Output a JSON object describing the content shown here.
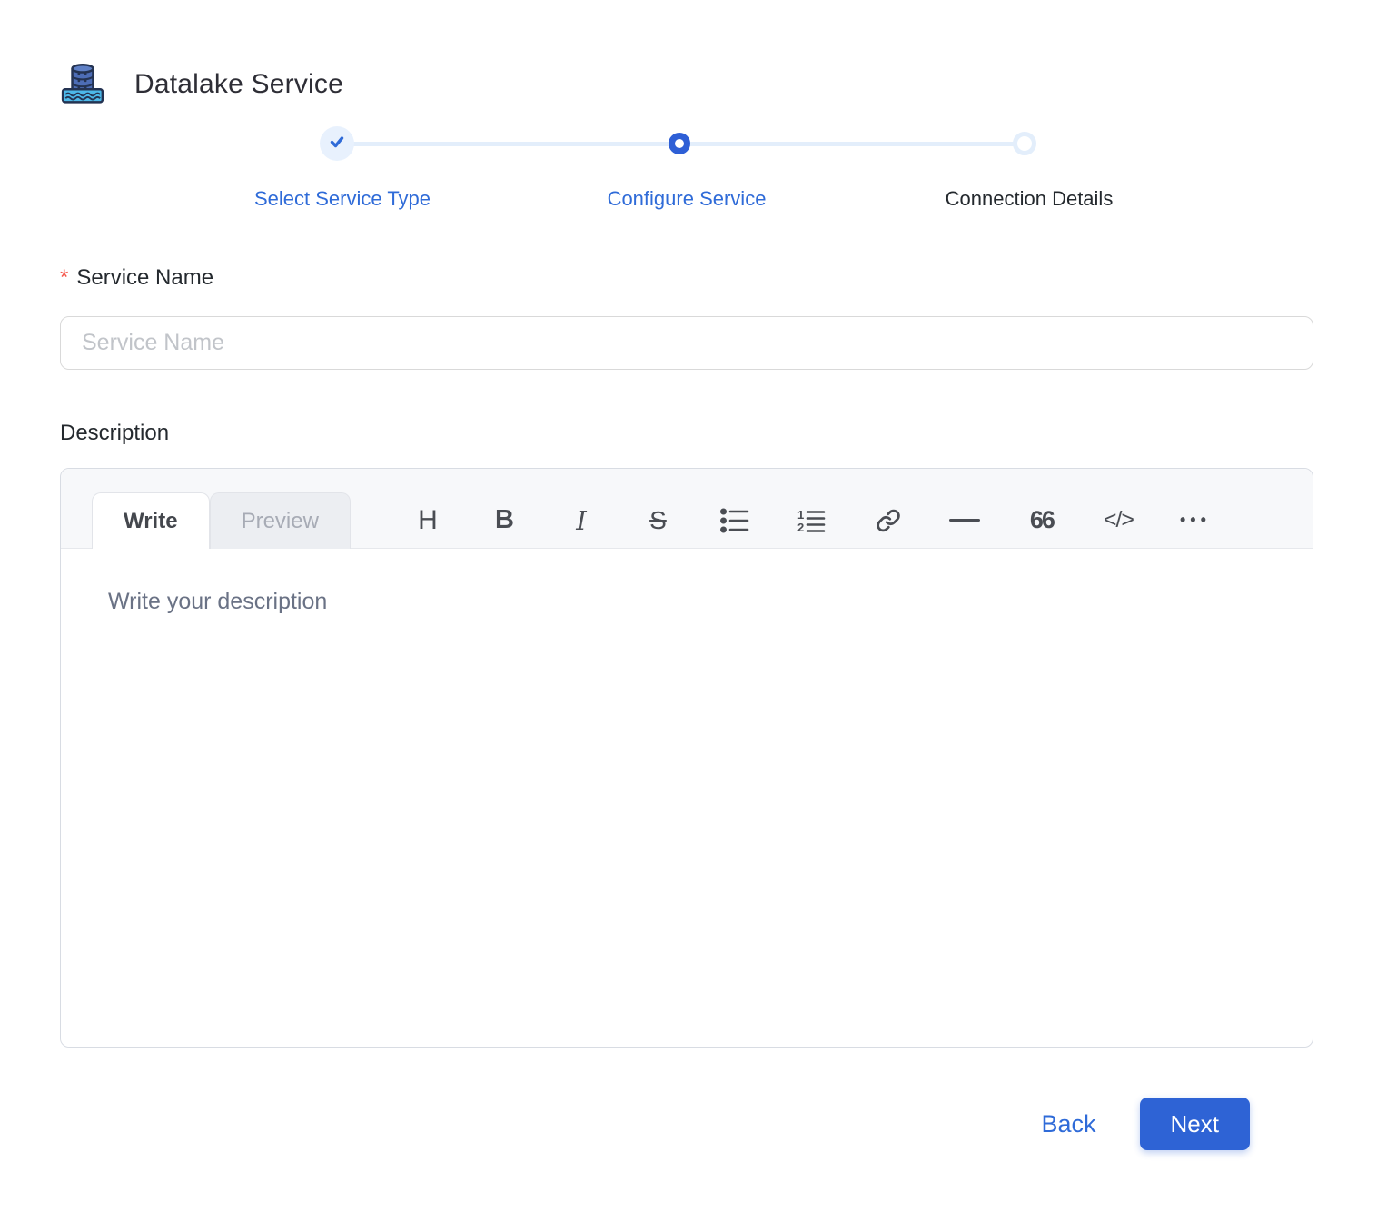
{
  "header": {
    "title": "Datalake Service"
  },
  "stepper": {
    "steps": [
      {
        "label": "Select Service Type",
        "state": "completed"
      },
      {
        "label": "Configure Service",
        "state": "active"
      },
      {
        "label": "Connection Details",
        "state": "pending"
      }
    ]
  },
  "form": {
    "service_name": {
      "label": "Service Name",
      "required_marker": "*",
      "placeholder": "Service Name",
      "value": ""
    },
    "description": {
      "label": "Description"
    }
  },
  "editor": {
    "tabs": [
      {
        "label": "Write",
        "active": true
      },
      {
        "label": "Preview",
        "active": false
      }
    ],
    "toolbar": [
      {
        "name": "heading-icon",
        "glyph": "H"
      },
      {
        "name": "bold-icon",
        "glyph": "B"
      },
      {
        "name": "italic-icon",
        "glyph": "I"
      },
      {
        "name": "strikethrough-icon",
        "glyph": "S"
      },
      {
        "name": "bullet-list-icon",
        "glyph": ""
      },
      {
        "name": "numbered-list-icon",
        "glyph": ""
      },
      {
        "name": "link-icon",
        "glyph": ""
      },
      {
        "name": "horizontal-rule-icon",
        "glyph": ""
      },
      {
        "name": "quote-icon",
        "glyph": "66"
      },
      {
        "name": "code-icon",
        "glyph": "</>"
      },
      {
        "name": "more-options-icon",
        "glyph": "•••"
      }
    ],
    "placeholder": "Write your description",
    "value": ""
  },
  "footer": {
    "back_label": "Back",
    "next_label": "Next"
  },
  "colors": {
    "accent_blue": "#2f6bd8",
    "primary_button_blue": "#2e63d5",
    "step_light_blue": "#e8f1fd",
    "required_red": "#f5554a"
  }
}
